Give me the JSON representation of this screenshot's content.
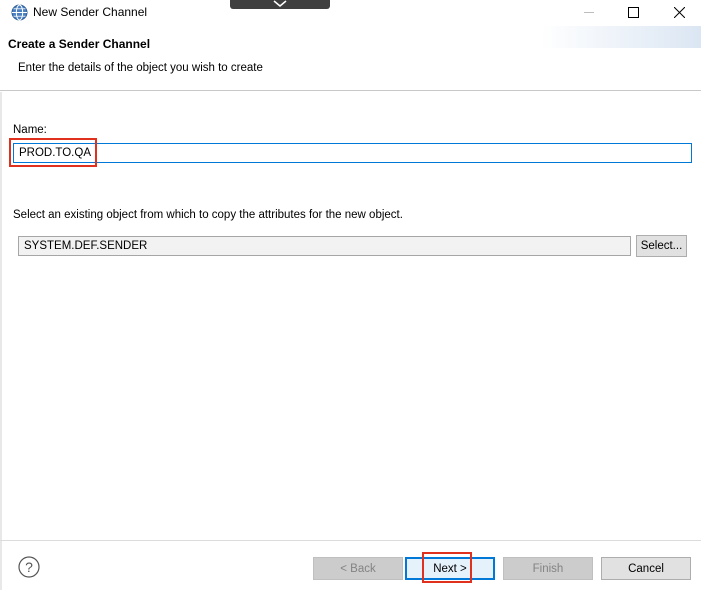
{
  "window": {
    "title": "New Sender Channel"
  },
  "banner": {
    "title": "Create a Sender Channel",
    "description": "Enter the details of the object you wish to create"
  },
  "name_field": {
    "label": "Name:",
    "value": "PROD.TO.QA"
  },
  "copy_from": {
    "label": "Select an existing object from which to copy the attributes for the new object.",
    "value": "SYSTEM.DEF.SENDER",
    "select_button": "Select..."
  },
  "footer": {
    "back": "< Back",
    "next": "Next >",
    "finish": "Finish",
    "cancel": "Cancel"
  },
  "colors": {
    "accent": "#0078d7",
    "highlight": "#e0301e"
  },
  "icons": {
    "app": "globe-icon",
    "help": "help-icon",
    "minimize": "minimize-icon",
    "maximize": "maximize-icon",
    "close": "close-icon"
  }
}
